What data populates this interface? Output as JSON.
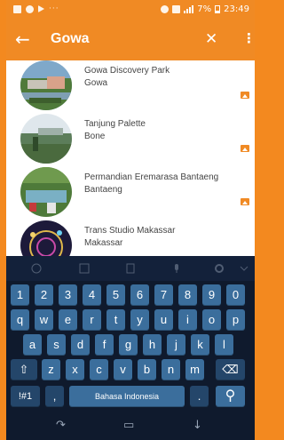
{
  "status_bar": {
    "time": "23:49",
    "battery": "7%"
  },
  "app_bar": {
    "title": "Gowa",
    "back_icon": "arrow-left-icon",
    "close_icon": "close-icon",
    "more_icon": "more-vertical-icon"
  },
  "places": [
    {
      "name": "Gowa Discovery Park",
      "location": "Gowa"
    },
    {
      "name": "Tanjung Palette",
      "location": "Bone"
    },
    {
      "name": "Permandian Eremarasa Bantaeng",
      "location": "Bantaeng"
    },
    {
      "name": "Trans Studio Makassar",
      "location": "Makassar"
    }
  ],
  "keyboard": {
    "numbers": [
      "1",
      "2",
      "3",
      "4",
      "5",
      "6",
      "7",
      "8",
      "9",
      "0"
    ],
    "row1": [
      "q",
      "w",
      "e",
      "r",
      "t",
      "y",
      "u",
      "i",
      "o",
      "p"
    ],
    "row2": [
      "a",
      "s",
      "d",
      "f",
      "g",
      "h",
      "j",
      "k",
      "l"
    ],
    "row3": [
      "z",
      "x",
      "c",
      "v",
      "b",
      "n",
      "m"
    ],
    "symbols_key": "!#1",
    "comma": ",",
    "space_label": "Bahasa Indonesia",
    "period": "."
  },
  "colors": {
    "accent": "#f08a24",
    "keyboard_bg": "#0f1a2d",
    "key": "#3b6e9c"
  }
}
